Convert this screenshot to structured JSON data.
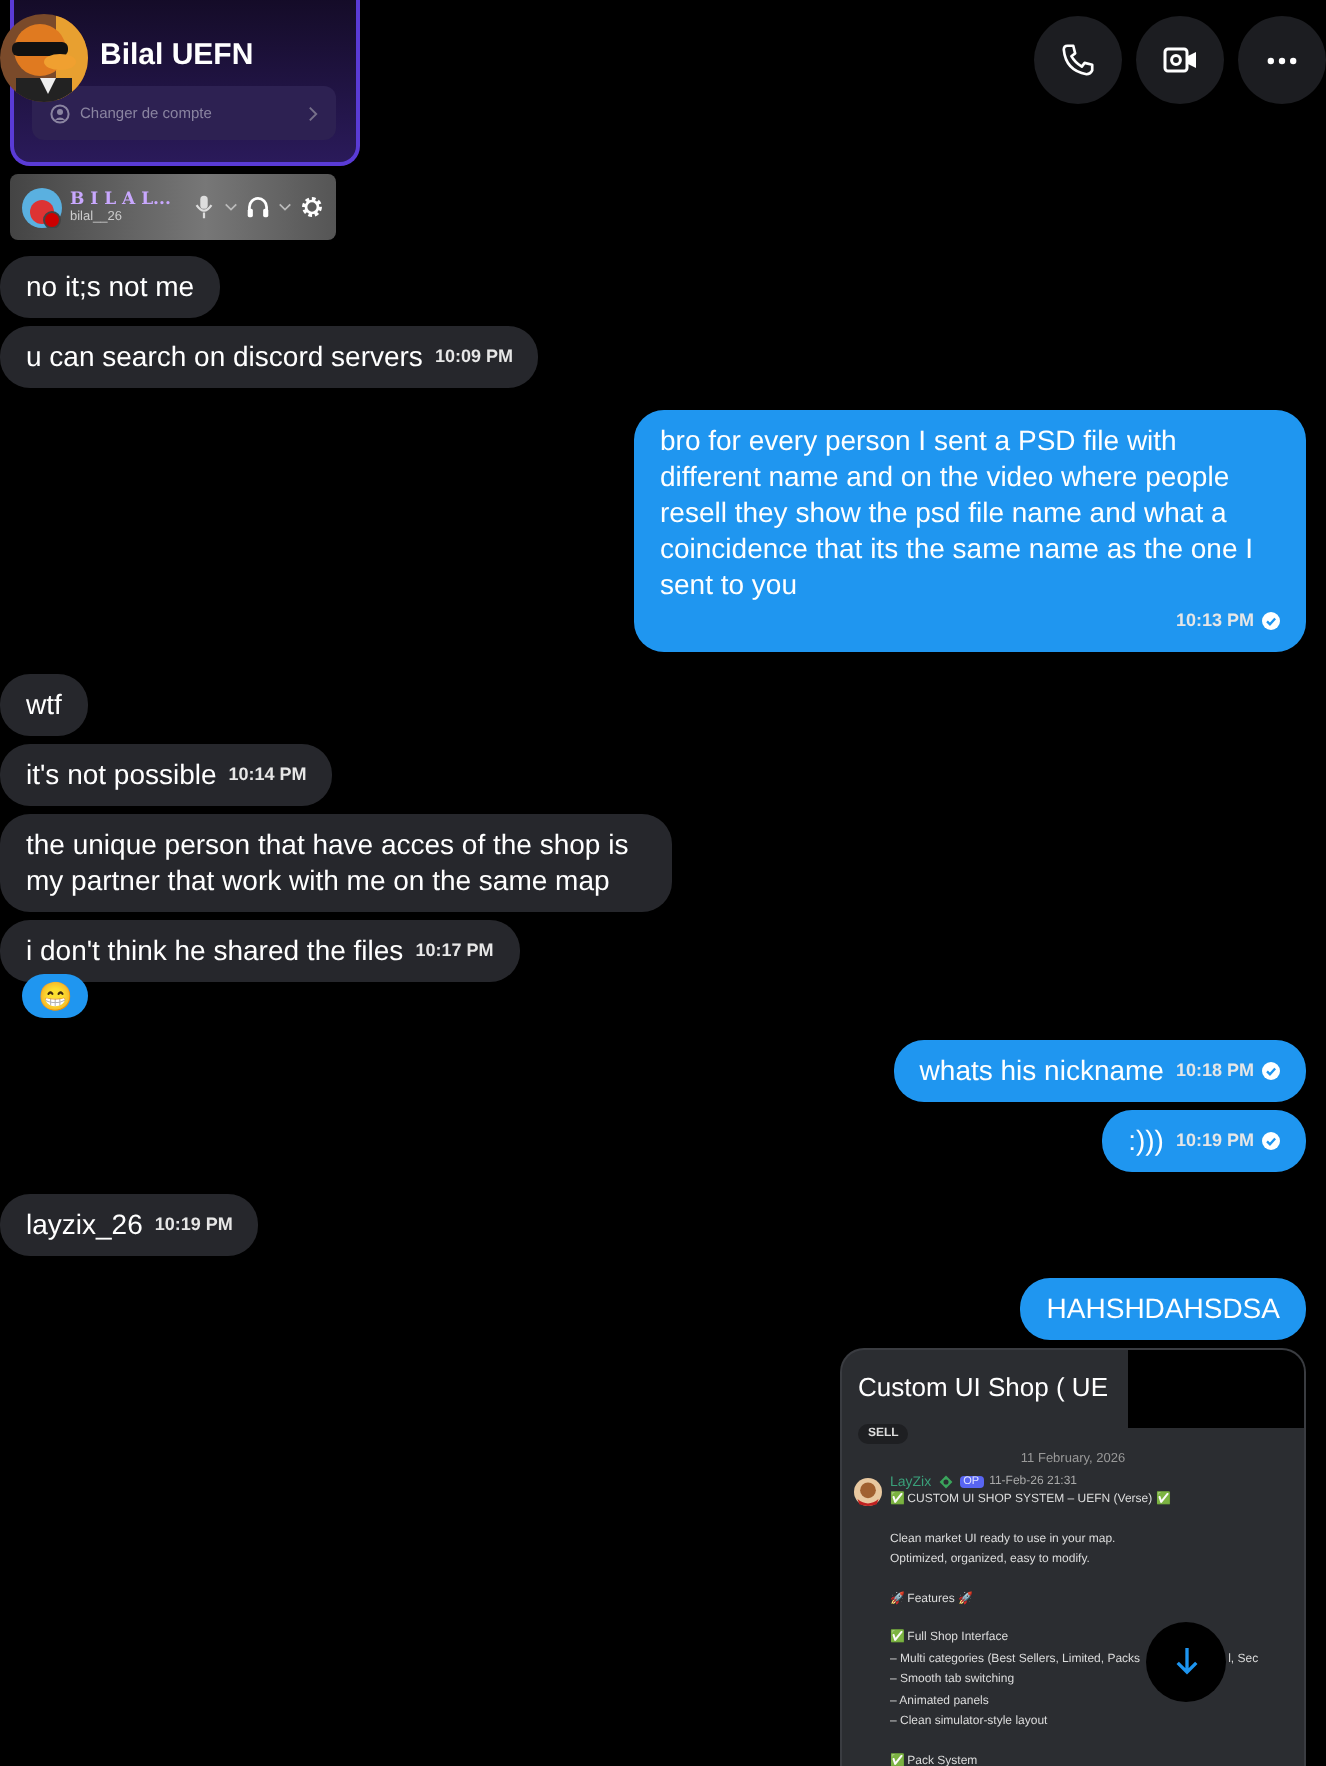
{
  "header": {
    "name": "Bilal UEFN",
    "actions": [
      {
        "kind": "call"
      },
      {
        "kind": "video"
      },
      {
        "kind": "more"
      }
    ]
  },
  "account_panel": {
    "switch_label": "Changer de compte",
    "display_name": "B I L A L...",
    "username": "bilal__26"
  },
  "messages": [
    {
      "outgoing": false,
      "kind": "text",
      "text": "no it;s not me"
    },
    {
      "outgoing": false,
      "kind": "text",
      "text": "u can search on discord servers",
      "time": "10:09 PM"
    },
    {
      "outgoing": true,
      "kind": "text",
      "text": "bro for every person I sent a PSD file with different name and on the video where people resell they show the psd file name and what a coincidence that its the same name as the one I sent to you",
      "time": "10:13 PM",
      "read": true
    },
    {
      "outgoing": false,
      "kind": "text",
      "text": "wtf"
    },
    {
      "outgoing": false,
      "kind": "text",
      "text": "it's not possible",
      "time": "10:14 PM"
    },
    {
      "outgoing": false,
      "kind": "text",
      "text": "the unique person that have acces of the shop is my partner that work with me on the same map"
    },
    {
      "outgoing": false,
      "kind": "text",
      "text": "i don't think he shared the files",
      "time": "10:17 PM",
      "reaction": "😁"
    },
    {
      "outgoing": true,
      "kind": "text",
      "text": "whats his nickname",
      "time": "10:18 PM",
      "read": true
    },
    {
      "outgoing": true,
      "kind": "text",
      "text": ":)))",
      "time": "10:19 PM",
      "read": true
    },
    {
      "outgoing": false,
      "kind": "text",
      "text": "layzix_26",
      "time": "10:19 PM"
    },
    {
      "outgoing": true,
      "kind": "text",
      "text": "HAHSHDAHSDSA"
    },
    {
      "outgoing": true,
      "kind": "screenshot",
      "title": "Custom UI Shop ( UE",
      "tag": "SELL",
      "date": "11 February, 2026",
      "author": "LayZix",
      "badge": "OP",
      "posted": "11-Feb-26 21:31",
      "lines": [
        {
          "kind": "line",
          "text": "✅  CUSTOM UI SHOP SYSTEM – UEFN (Verse) ✅"
        },
        {
          "kind": "blank"
        },
        {
          "kind": "line",
          "text": "Clean market UI ready to use in your map."
        },
        {
          "kind": "line",
          "text": "Optimized, organized, easy to modify."
        },
        {
          "kind": "blank"
        },
        {
          "kind": "line",
          "text": "🚀 Features 🚀"
        },
        {
          "kind": "blank"
        },
        {
          "kind": "line",
          "text": "✅ Full Shop Interface"
        },
        {
          "kind": "split",
          "text": "– Multi categories (Best Sellers, Limited, Packs",
          "rest": "l, Sec"
        },
        {
          "kind": "line",
          "text": "– Smooth tab switching"
        },
        {
          "kind": "line",
          "text": "– Animated panels"
        },
        {
          "kind": "line",
          "text": "– Clean simulator-style layout"
        },
        {
          "kind": "blank"
        },
        {
          "kind": "line",
          "text": "✅ Pack System"
        }
      ]
    }
  ]
}
